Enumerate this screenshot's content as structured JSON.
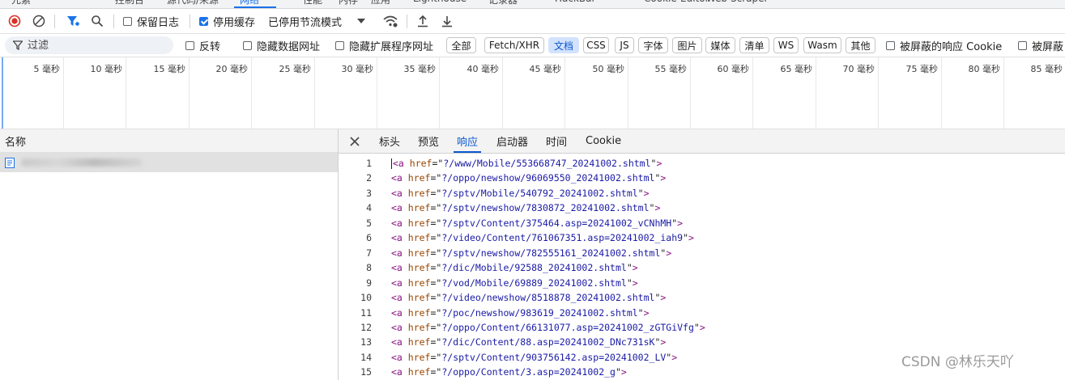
{
  "top_tabs": [
    {
      "label": "元素",
      "active": false
    },
    {
      "label": "控制台",
      "active": false
    },
    {
      "label": "源代码/来源",
      "active": false
    },
    {
      "label": "网络",
      "active": true
    },
    {
      "label": "性能",
      "active": false
    },
    {
      "label": "内存",
      "active": false
    },
    {
      "label": "应用",
      "active": false
    },
    {
      "label": "Lighthouse",
      "active": false
    },
    {
      "label": "记录器",
      "active": false
    },
    {
      "label": "HackBar",
      "active": false
    },
    {
      "label": "Cookie-Editor",
      "active": false
    },
    {
      "label": "Web Scraper",
      "active": false
    }
  ],
  "toolbar": {
    "record_icon": "record-stop-icon",
    "clear_icon": "clear-icon",
    "filter_icon": "filter-icon",
    "search_icon": "search-icon",
    "preserve_log": {
      "label": "保留日志",
      "checked": false
    },
    "disable_cache": {
      "label": "停用缓存",
      "checked": true
    },
    "throttle": {
      "label": "已停用节流模式"
    },
    "wifi_icon": "network-conditions-icon",
    "upload_icon": "import-har-icon",
    "download_icon": "export-har-icon"
  },
  "filterbar": {
    "placeholder": "过滤",
    "invert": {
      "label": "反转",
      "checked": false
    },
    "hide_data_urls": {
      "label": "隐藏数据网址",
      "checked": false
    },
    "hide_ext_urls": {
      "label": "隐藏扩展程序网址",
      "checked": false
    },
    "types": [
      {
        "label": "全部",
        "active": false
      },
      {
        "label": "Fetch/XHR",
        "active": false
      },
      {
        "label": "文档",
        "active": true
      },
      {
        "label": "CSS",
        "active": false
      },
      {
        "label": "JS",
        "active": false
      },
      {
        "label": "字体",
        "active": false
      },
      {
        "label": "图片",
        "active": false
      },
      {
        "label": "媒体",
        "active": false
      },
      {
        "label": "清单",
        "active": false
      },
      {
        "label": "WS",
        "active": false
      },
      {
        "label": "Wasm",
        "active": false
      },
      {
        "label": "其他",
        "active": false
      }
    ],
    "blocked_cookies": {
      "label": "被屏蔽的响应 Cookie",
      "checked": false
    },
    "blocked_requests": {
      "label": "被屏蔽",
      "checked": false
    }
  },
  "overview": {
    "ticks": [
      "5 毫秒",
      "10 毫秒",
      "15 毫秒",
      "20 毫秒",
      "25 毫秒",
      "30 毫秒",
      "35 毫秒",
      "40 毫秒",
      "45 毫秒",
      "50 毫秒",
      "55 毫秒",
      "60 毫秒",
      "65 毫秒",
      "70 毫秒",
      "75 毫秒",
      "80 毫秒",
      "85 毫秒"
    ]
  },
  "name_panel": {
    "header": "名称",
    "row_icon": "document-icon"
  },
  "detail_tabs": {
    "close_icon": "close-icon",
    "tabs": [
      {
        "label": "标头",
        "active": false
      },
      {
        "label": "预览",
        "active": false
      },
      {
        "label": "响应",
        "active": true
      },
      {
        "label": "启动器",
        "active": false
      },
      {
        "label": "时间",
        "active": false
      },
      {
        "label": "Cookie",
        "active": false
      }
    ]
  },
  "response_lines": [
    {
      "n": "1",
      "href": "?/www/Mobile/553668747_20241002.shtml"
    },
    {
      "n": "2",
      "href": "?/oppo/newshow/96069550_20241002.shtml"
    },
    {
      "n": "3",
      "href": "?/sptv/Mobile/540792_20241002.shtml"
    },
    {
      "n": "4",
      "href": "?/sptv/newshow/7830872_20241002.shtml"
    },
    {
      "n": "5",
      "href": "?/sptv/Content/375464.asp=20241002_vCNhMH"
    },
    {
      "n": "6",
      "href": "?/video/Content/761067351.asp=20241002_iah9"
    },
    {
      "n": "7",
      "href": "?/sptv/newshow/782555161_20241002.shtml"
    },
    {
      "n": "8",
      "href": "?/dic/Mobile/92588_20241002.shtml"
    },
    {
      "n": "9",
      "href": "?/vod/Mobile/69889_20241002.shtml"
    },
    {
      "n": "10",
      "href": "?/video/newshow/8518878_20241002.shtml"
    },
    {
      "n": "11",
      "href": "?/poc/newshow/983619_20241002.shtml"
    },
    {
      "n": "12",
      "href": "?/oppo/Content/66131077.asp=20241002_zGTGiVfg"
    },
    {
      "n": "13",
      "href": "?/dic/Content/88.asp=20241002_DNc731sK"
    },
    {
      "n": "14",
      "href": "?/sptv/Content/903756142.asp=20241002_LV"
    },
    {
      "n": "15",
      "href": "?/oppo/Content/3.asp=20241002_g"
    }
  ],
  "watermark": "CSDN @林乐天吖"
}
